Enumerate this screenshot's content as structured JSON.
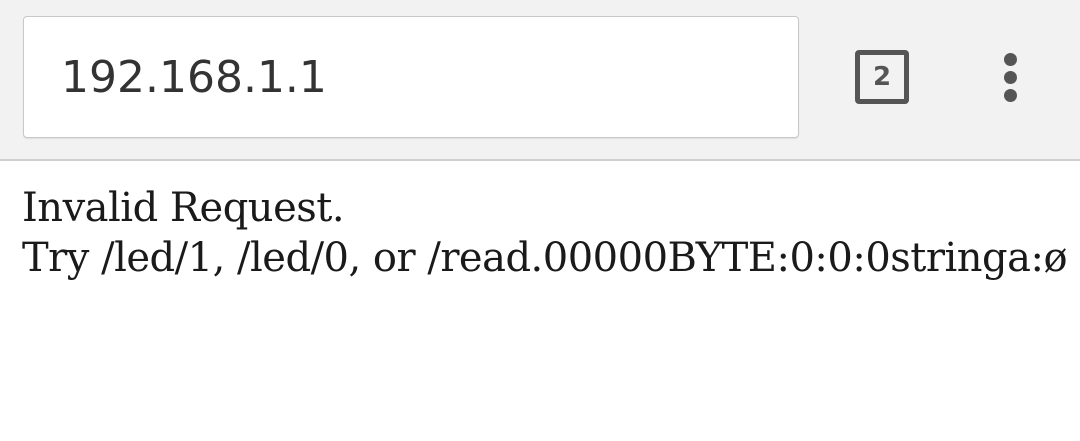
{
  "browser": {
    "address_bar": {
      "url": "192.168.1.1"
    },
    "tab_switcher": {
      "count": "2"
    },
    "menu": {
      "icon": "more-vert-icon"
    }
  },
  "page": {
    "lines": [
      "Invalid Request.",
      "Try /led/1, /led/0, or /read.00000BYTE:0:0:0stringa:ø"
    ]
  },
  "colors": {
    "toolbar_background": "#f2f2f2",
    "icon_color": "#555555",
    "text_color": "#1a1a1a"
  }
}
